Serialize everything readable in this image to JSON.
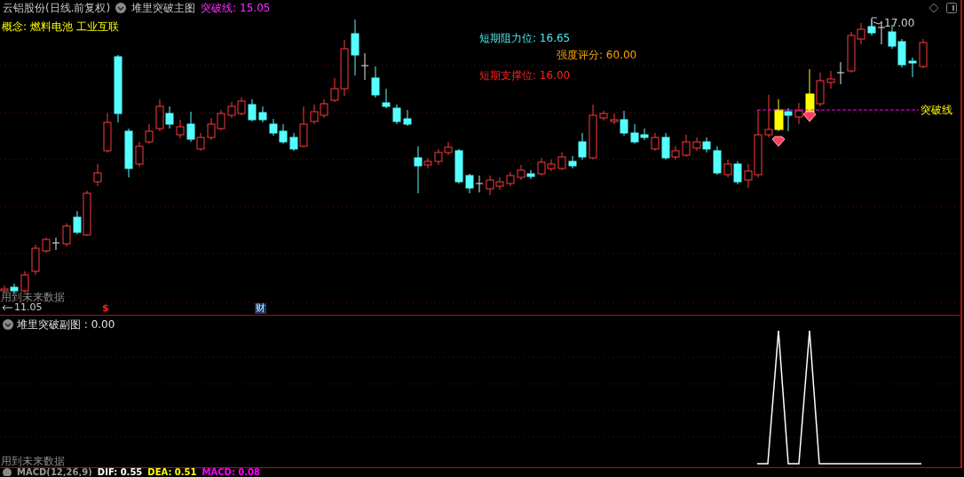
{
  "header": {
    "stock": "云铝股份(日线.前复权)",
    "indicator": "堆里突破主图",
    "break_line": "突破线: 15.05"
  },
  "concepts": "概念: 燃料电池 工业互联",
  "annotations": [
    {
      "text": "短期阻力位: 16.65",
      "color": "#4de8f0"
    },
    {
      "text": "强度评分: 60.00",
      "color": "#ffa500"
    },
    {
      "text": "短期支撑位: 16.00",
      "color": "#ff2020"
    }
  ],
  "high_label": "17.00",
  "low_label": "11.05",
  "break_line_label": "突破线",
  "main_warning": "用到未来数据",
  "markers": [
    {
      "kind": "dollar",
      "text": "$"
    },
    {
      "kind": "finance",
      "text": "财"
    }
  ],
  "sub_panel": {
    "title": "堆里突破副图 : 0.00",
    "warning": "用到未来数据"
  },
  "macd_bar": [
    {
      "text": "MACD(12,26,9)",
      "color": "#9a9a9a"
    },
    {
      "text": "DIF: 0.55",
      "color": "#ffffff"
    },
    {
      "text": "DEA: 0.51",
      "color": "#ffff00"
    },
    {
      "text": "MACD: 0.08",
      "color": "#ff00ff"
    }
  ]
}
